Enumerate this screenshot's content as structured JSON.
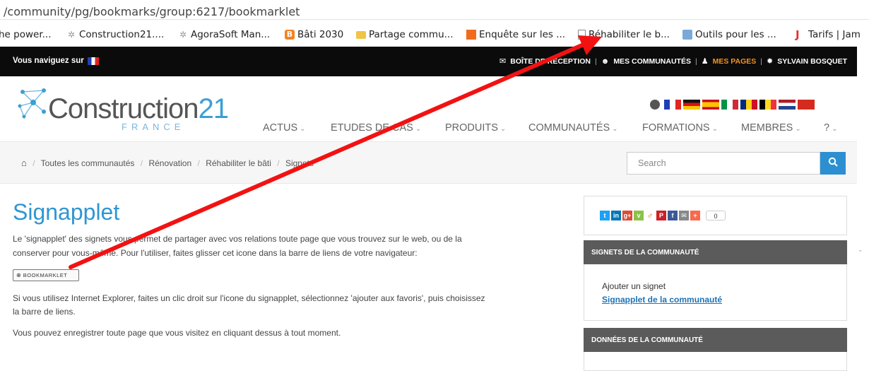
{
  "browser": {
    "url": "/community/pg/bookmarks/group:6217/bookmarklet"
  },
  "bookmarks_bar": [
    {
      "icon": "page-icon",
      "label": "he power..."
    },
    {
      "icon": "construction21-icon",
      "label": "Construction21...."
    },
    {
      "icon": "construction21-icon",
      "label": "AgoraSoft Man..."
    },
    {
      "icon": "blogger-icon",
      "label": "Bâti 2030"
    },
    {
      "icon": "folder-icon",
      "label": "Partage commu..."
    },
    {
      "icon": "survey-icon",
      "label": "Enquête sur les ..."
    },
    {
      "icon": "page-icon",
      "label": "Réhabiliter le b..."
    },
    {
      "icon": "tools-icon",
      "label": "Outils pour les ..."
    },
    {
      "icon": "j-icon",
      "label": "Tarifs | Jam"
    }
  ],
  "topbar": {
    "browsing_label": "Vous naviguez sur",
    "inbox": "BOÎTE DE RÉCEPTION",
    "communities": "MES COMMUNAUTÉS",
    "pages": "MES PAGES",
    "user": "SYLVAIN BOSQUET",
    "separator": "|",
    "accent_color": "#f39222"
  },
  "logo": {
    "word": "Construction",
    "number": "21",
    "country": "FRANCE"
  },
  "flags": [
    "globe",
    "fr",
    "de",
    "es",
    "it",
    "ro",
    "be",
    "ma",
    "nl",
    "ca"
  ],
  "nav": [
    {
      "label": "ACTUS"
    },
    {
      "label": "ETUDES DE CAS"
    },
    {
      "label": "PRODUITS"
    },
    {
      "label": "COMMUNAUTÉS"
    },
    {
      "label": "FORMATIONS"
    },
    {
      "label": "MEMBRES"
    },
    {
      "label": "?"
    }
  ],
  "breadcrumb": {
    "home_icon": "home-icon",
    "items": [
      "Toutes les communautés",
      "Rénovation",
      "Réhabiliter le bâti",
      "Signets"
    ],
    "sep": "/"
  },
  "search": {
    "placeholder": "Search",
    "button_icon": "search-icon"
  },
  "main": {
    "title": "Signapplet",
    "para1_line1": "Le 'signapplet' des signets vous permet de partager avec vos relations toute page que vous trouvez sur le web, ou de la",
    "para1_line2": "conserver pour vous-même. Pour l'utiliser, faites glisser cet icone dans la barre de liens de votre navigateur:",
    "bookmarklet_label": "BOOKMARKLET",
    "para2_line1": "Si vous utilisez Internet Explorer, faites un clic droit sur l'icone du signapplet, sélectionnez 'ajouter aux favoris', puis choisissez",
    "para2_line2": "la barre de liens.",
    "para3": "Vous pouvez enregistrer toute page que vous visitez en cliquant dessus à tout moment."
  },
  "sidebar": {
    "share_icons": [
      "twitter",
      "linkedin",
      "googleplus",
      "viadeo",
      "delicious",
      "pinterest",
      "facebook",
      "email",
      "addthis"
    ],
    "share_count": "0",
    "bookmarks_head": "SIGNETS DE LA COMMUNAUTÉ",
    "add_bookmark": "Ajouter un signet",
    "community_signapplet": "Signapplet de la communauté",
    "data_head": "DONNÉES DE LA COMMUNAUTÉ"
  },
  "colors": {
    "brand_blue": "#2f96d2",
    "annotation_arrow": "#ff0000"
  }
}
